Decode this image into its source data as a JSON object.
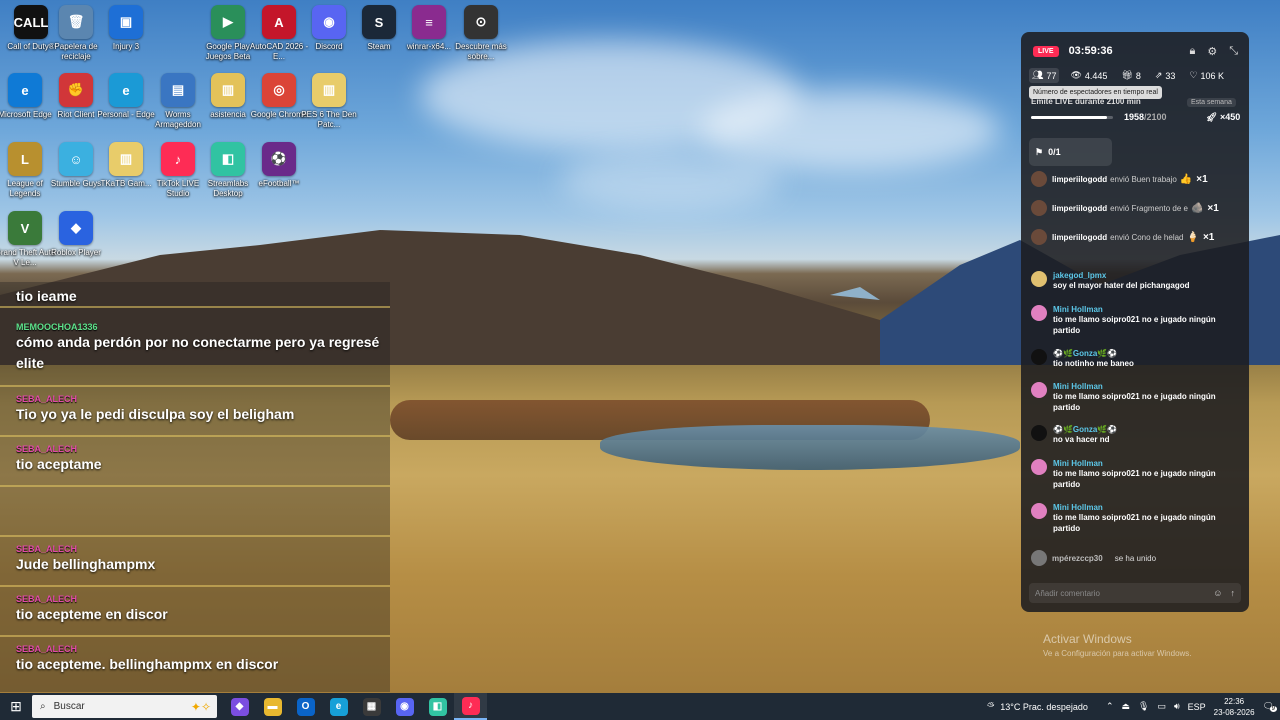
{
  "desktop_icons": [
    {
      "label": "Call of Duty®",
      "glyph": "CALL",
      "color": "#111111"
    },
    {
      "label": "Papelera de reciclaje",
      "glyph": "🗑",
      "color": "#5b86b0"
    },
    {
      "label": "Injury 3",
      "glyph": "▣",
      "color": "#1e6fd6"
    },
    {
      "label": "Google Play Juegos Beta",
      "glyph": "▶",
      "color": "#2a8f5a"
    },
    {
      "label": "AutoCAD 2026 - E...",
      "glyph": "A",
      "color": "#c4162a"
    },
    {
      "label": "Discord",
      "glyph": "◉",
      "color": "#5865f2"
    },
    {
      "label": "Steam",
      "glyph": "S",
      "color": "#1b2838"
    },
    {
      "label": "winrar-x64...",
      "glyph": "≡",
      "color": "#8a2b8f"
    },
    {
      "label": "Descubre más sobre...",
      "glyph": "⊙",
      "color": "#333333"
    },
    {
      "label": "Microsoft Edge",
      "glyph": "e",
      "color": "#0f7ad6"
    },
    {
      "label": "Riot Client",
      "glyph": "✊",
      "color": "#d13639"
    },
    {
      "label": "Personal - Edge",
      "glyph": "e",
      "color": "#1b9ad6"
    },
    {
      "label": "Worms Armageddon",
      "glyph": "▤",
      "color": "#3a76c2"
    },
    {
      "label": "asistencia",
      "glyph": "▥",
      "color": "#e3c25a"
    },
    {
      "label": "Google Chrome",
      "glyph": "◎",
      "color": "#db4437"
    },
    {
      "label": "PES 6 The Den Patc...",
      "glyph": "▥",
      "color": "#e8cc6a"
    },
    {
      "label": "League of Legends",
      "glyph": "L",
      "color": "#b8902f"
    },
    {
      "label": "Stumble Guys",
      "glyph": "☺",
      "color": "#3bb0e0"
    },
    {
      "label": "TKaTB Gam...",
      "glyph": "▥",
      "color": "#e8cc6a"
    },
    {
      "label": "TikTok LIVE Studio",
      "glyph": "♪",
      "color": "#fe2c55"
    },
    {
      "label": "Streamlabs Desktop",
      "glyph": "◧",
      "color": "#31c3a2"
    },
    {
      "label": "eFootball™",
      "glyph": "⚽",
      "color": "#6a2a8a"
    },
    {
      "label": "Grand Theft Auto V Le...",
      "glyph": "V",
      "color": "#3a7a3a"
    },
    {
      "label": "Roblox Player",
      "glyph": "◆",
      "color": "#2a63e0"
    }
  ],
  "chat_overlay": {
    "messages": [
      {
        "user": "",
        "text": "tio ieame",
        "user_color": ""
      },
      {
        "user": "MEMOOCHOA1336",
        "text": "cómo anda perdón por no conectarme pero ya regresé elite",
        "user_color": "green"
      },
      {
        "user": "SEBA_ALECH",
        "text": "Tio yo ya le pedi disculpa soy el beligham",
        "user_color": "pink"
      },
      {
        "user": "SEBA_ALECH",
        "text": "tio aceptame",
        "user_color": "pink"
      },
      {
        "user": "SEBA_ALECH",
        "text": "Jude bellinghampmx",
        "user_color": "pink"
      },
      {
        "user": "SEBA_ALECH",
        "text": "tio acepteme en discor",
        "user_color": "pink"
      },
      {
        "user": "SEBA_ALECH",
        "text": "tio acepteme. bellinghampmx en discor",
        "user_color": "pink"
      }
    ]
  },
  "live_panel": {
    "badge": "LIVE",
    "timer": "03:59:36",
    "stats": {
      "viewers": "77",
      "views": "4.445",
      "gifts": "8",
      "shares": "33",
      "likes": "106 K"
    },
    "tooltip": "Número de espectadores en tiempo real",
    "goal_text": "Emite LIVE durante 2100 min",
    "week_badge": "Esta semana",
    "progress_current": "1958",
    "progress_total": "/2100",
    "progress_fraction": 0.932,
    "multiplier": "×450",
    "lucky": "0/1",
    "gifts": [
      {
        "user": "limperiilogodd",
        "action": "envió Buen trabajo",
        "emoji": "👍",
        "count": "×1"
      },
      {
        "user": "limperiilogodd",
        "action": "envió Fragmento de e",
        "emoji": "🪨",
        "count": "×1"
      },
      {
        "user": "limperiilogodd",
        "action": "envió Cono de helad",
        "emoji": "🍦",
        "count": "×1"
      }
    ],
    "comments": [
      {
        "name": "jakegod_lpmx",
        "text": "soy el mayor hater del pichangagod",
        "avatar": "#e0c070"
      },
      {
        "name": "Mini Hollman",
        "text": "tio me llamo soipro021 no e jugado ningún partido",
        "avatar": "#e080c0"
      },
      {
        "name": "⚽🌿Gonza🌿⚽",
        "text": "tio notinho me baneo",
        "avatar": "#111111"
      },
      {
        "name": "Mini Hollman",
        "text": "tio me llamo soipro021 no e jugado ningún partido",
        "avatar": "#e080c0"
      },
      {
        "name": "⚽🌿Gonza🌿⚽",
        "text": "no va hacer nd",
        "avatar": "#111111"
      },
      {
        "name": "Mini Hollman",
        "text": "tio me llamo soipro021 no e jugado ningún partido",
        "avatar": "#e080c0"
      },
      {
        "name": "Mini Hollman",
        "text": "tio me llamo soipro021 no e jugado ningún partido",
        "avatar": "#e080c0"
      }
    ],
    "join": {
      "user": "mpérezccp30",
      "text": "se ha unido"
    },
    "comment_placeholder": "Añadir comentario"
  },
  "watermark": {
    "line1": "Activar Windows",
    "line2": "Ve a Configuración para activar Windows."
  },
  "taskbar": {
    "search_placeholder": "Buscar",
    "weather": "13°C  Prac. despejado",
    "language": "ESP",
    "time": "22:36",
    "date": "23-08-2026",
    "notification_count": "9",
    "apps": [
      {
        "name": "copilot",
        "glyph": "◆",
        "color": "#7b4ee0"
      },
      {
        "name": "file-explorer",
        "glyph": "▬",
        "color": "#e8b830"
      },
      {
        "name": "outlook",
        "glyph": "O",
        "color": "#0a64c8"
      },
      {
        "name": "edge",
        "glyph": "e",
        "color": "#17a0d8"
      },
      {
        "name": "store",
        "glyph": "▦",
        "color": "#3a3a3a"
      },
      {
        "name": "discord",
        "glyph": "◉",
        "color": "#5865f2"
      },
      {
        "name": "streamlabs",
        "glyph": "◧",
        "color": "#31c3a2"
      },
      {
        "name": "tiktok-live",
        "glyph": "♪",
        "color": "#fe2c55"
      }
    ]
  }
}
